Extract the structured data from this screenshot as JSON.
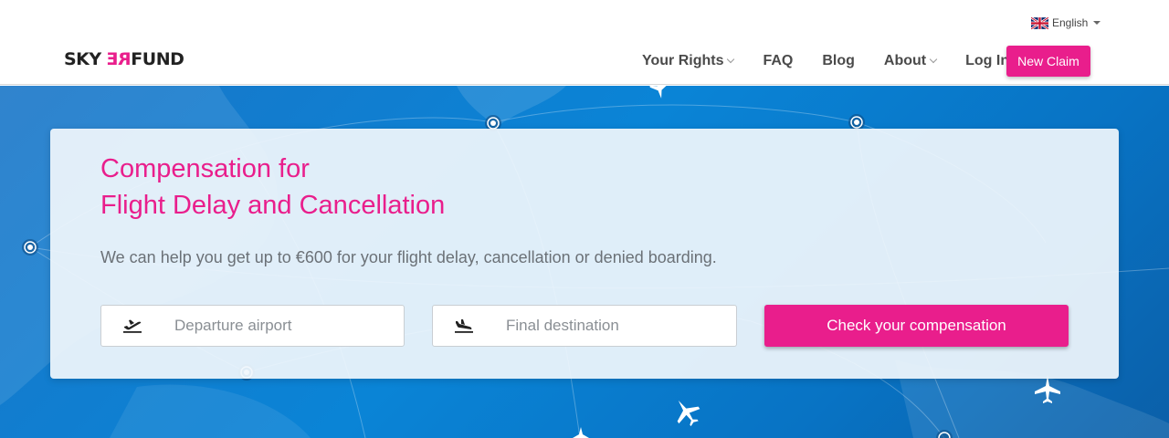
{
  "header": {
    "language": "English",
    "logo": {
      "part1": "SKY",
      "part2": "RE",
      "part3": "FUND"
    },
    "nav": [
      {
        "label": "Your Rights",
        "dropdown": true
      },
      {
        "label": "FAQ",
        "dropdown": false
      },
      {
        "label": "Blog",
        "dropdown": false
      },
      {
        "label": "About",
        "dropdown": true
      },
      {
        "label": "Log In",
        "dropdown": false
      }
    ],
    "new_claim_label": "New Claim"
  },
  "hero": {
    "title_line1": "Compensation for",
    "title_line2": "Flight Delay and Cancellation",
    "subtitle": "We can help you get up to €600 for your flight delay, cancellation or denied boarding.",
    "departure_placeholder": "Departure airport",
    "destination_placeholder": "Final destination",
    "check_button_label": "Check your compensation"
  },
  "colors": {
    "brand_pink": "#e91e8c",
    "hero_blue": "#0a84d6"
  },
  "icons": [
    "uk-flag-icon",
    "takeoff-icon",
    "landing-icon",
    "airplane-icon",
    "airport-marker-icon"
  ]
}
